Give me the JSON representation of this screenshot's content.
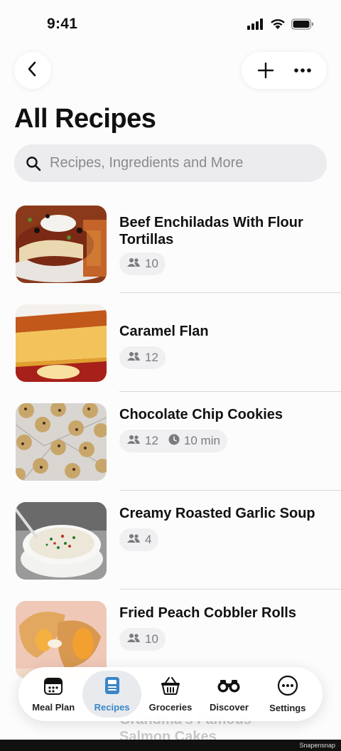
{
  "status_bar": {
    "time": "9:41"
  },
  "nav": {
    "back_icon": "chevron-left-icon",
    "add_icon": "plus-icon",
    "more_icon": "ellipsis-icon"
  },
  "page": {
    "title": "All Recipes"
  },
  "search": {
    "placeholder": "Recipes, Ingredients and More",
    "value": ""
  },
  "recipes": [
    {
      "title": "Beef Enchiladas With Flour Tortillas",
      "servings": "10",
      "time": ""
    },
    {
      "title": "Caramel Flan",
      "servings": "12",
      "time": ""
    },
    {
      "title": "Chocolate Chip Cookies",
      "servings": "12",
      "time": "10 min"
    },
    {
      "title": "Creamy Roasted Garlic Soup",
      "servings": "4",
      "time": ""
    },
    {
      "title": "Fried Peach Cobbler Rolls",
      "servings": "10",
      "time": ""
    }
  ],
  "partial_recipe": {
    "title": "Grandma's Famous Salmon Cakes"
  },
  "tab_bar": {
    "tabs": [
      {
        "label": "Meal Plan",
        "icon": "calendar-icon"
      },
      {
        "label": "Recipes",
        "icon": "recipe-card-icon",
        "active": true
      },
      {
        "label": "Groceries",
        "icon": "basket-icon"
      },
      {
        "label": "Discover",
        "icon": "binoculars-icon"
      },
      {
        "label": "Settings",
        "icon": "ellipsis-circle-icon"
      }
    ]
  },
  "watermark": "Snapensnap",
  "colors": {
    "accent": "#3a86c8",
    "chip_bg": "#f0f0f2",
    "background": "#fcfcfc"
  }
}
